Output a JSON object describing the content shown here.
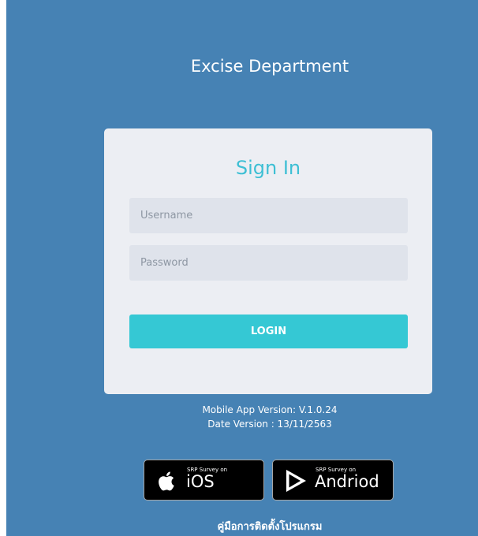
{
  "header": {
    "title": "Excise Department"
  },
  "login": {
    "title": "Sign In",
    "username_placeholder": "Username",
    "password_placeholder": "Password",
    "button_label": "LOGIN"
  },
  "version": {
    "app": "Mobile App Version: V.1.0.24",
    "date": "Date Version : 13/11/2563"
  },
  "stores": {
    "ios": {
      "small": "SRP Survey on",
      "big": "iOS",
      "icon": "apple-icon"
    },
    "android": {
      "small": "SRP Survey on",
      "big": "Andriod",
      "icon": "play-icon"
    }
  },
  "manual_link": "คู่มือการติดตั้งโปรแกรม",
  "colors": {
    "background": "#4682b4",
    "card": "#eceef3",
    "accent": "#35c8d4",
    "title": "#3dbfd4"
  }
}
